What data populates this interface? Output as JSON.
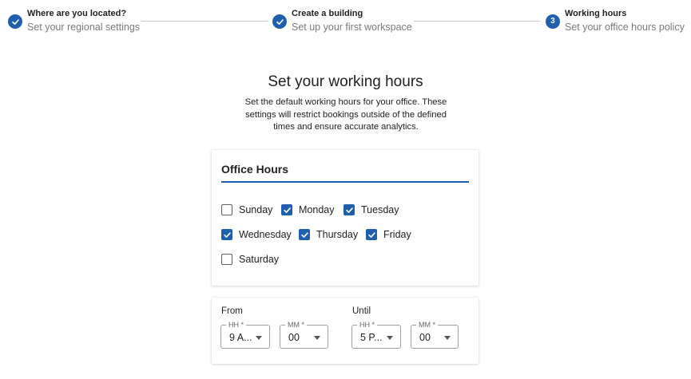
{
  "stepper": {
    "steps": [
      {
        "title": "Where are you located?",
        "subtitle": "Set your regional settings",
        "status": "completed"
      },
      {
        "title": "Create a building",
        "subtitle": "Set up your first workspace",
        "status": "completed"
      },
      {
        "title": "Working hours",
        "subtitle": "Set your office hours policy",
        "status": "active",
        "number": "3"
      }
    ]
  },
  "page": {
    "heading": "Set your working hours",
    "description": "Set the default working hours for your office. These settings will restrict bookings outside of the defined times and ensure accurate analytics."
  },
  "office_hours": {
    "title": "Office Hours",
    "days": [
      {
        "label": "Sunday",
        "checked": false
      },
      {
        "label": "Monday",
        "checked": true
      },
      {
        "label": "Tuesday",
        "checked": true
      },
      {
        "label": "Wednesday",
        "checked": true
      },
      {
        "label": "Thursday",
        "checked": true
      },
      {
        "label": "Friday",
        "checked": true
      },
      {
        "label": "Saturday",
        "checked": false
      }
    ]
  },
  "time": {
    "from": {
      "label": "From",
      "hh_label": "HH *",
      "hh_value": "9 A...",
      "mm_label": "MM *",
      "mm_value": "00"
    },
    "until": {
      "label": "Until",
      "hh_label": "HH *",
      "hh_value": "5 P...",
      "mm_label": "MM *",
      "mm_value": "00"
    }
  },
  "colors": {
    "accent": "#1f5fae",
    "muted_text": "#7a7a7a",
    "connector": "#c8c8c8"
  }
}
